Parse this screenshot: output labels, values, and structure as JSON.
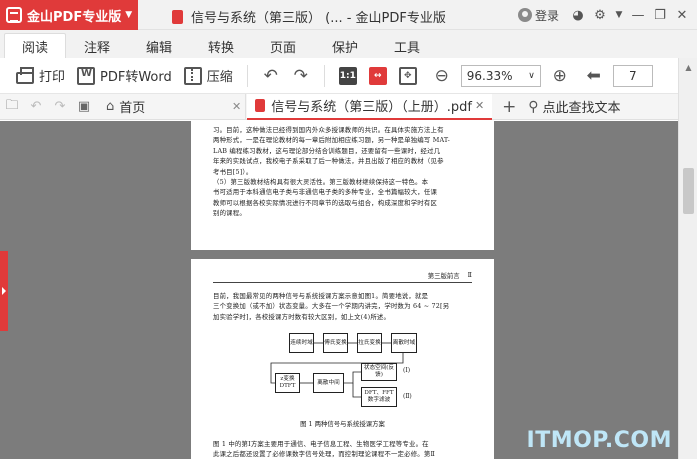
{
  "app": {
    "name": "金山PDF专业版",
    "window_title": "信号与系统（第三版） (... - 金山PDF专业版",
    "login_label": "登录",
    "brand_color": "#e03a3a"
  },
  "window_controls": [
    "chat-icon",
    "settings-icon",
    "dropdown-icon",
    "minimize-icon",
    "restore-icon",
    "close-icon"
  ],
  "menu": {
    "items": [
      "阅读",
      "注释",
      "编辑",
      "转换",
      "页面",
      "保护",
      "工具"
    ],
    "active": "阅读"
  },
  "toolbar": {
    "print_label": "打印",
    "pdf_to_word_label": "PDF转Word",
    "compress_label": "压缩",
    "actual_size_label": "1:1",
    "zoom_value": "96.33%",
    "page_number": "7"
  },
  "tabs": {
    "home_label": "首页",
    "doc_label": "信号与系统（第三版）（上册）.pdf",
    "search_label": "点此查找文本"
  },
  "document": {
    "page1_lines": [
      "习。目前，这种做法已经得到国内外众多授课教师的共识。在具体实施方法上有",
      "两种形式，一是在理论教材的每一章后附加相应练习题，另一种是单独编写 MAT-",
      "LAB 编程练习教材，这与理论部分结合训练题目，还要留有一些课时，经过几",
      "年来的实践试点，我校电子系采取了后一种做法，并且出版了相应的教材（见参",
      "考书目[5]）。",
      "（5）第三版教材结构具有很大灵活性。第三版教材继续保持这一特色。本",
      "书可适用于本科通信电子类与非通信电子类的多种专业，全书篇幅较大，任课",
      "教师可以根据各校实际情况进行不同章节的选取与组合，构成深度和学时有区",
      "别的课程。"
    ],
    "page2_header_title": "第三版前言",
    "page2_header_num": "Ⅱ",
    "page2_intro_lines": [
      "目前，我国最常见的两种信号与系统授课方案示意如图1。简要地说，就是",
      "三个变换加（或不加）状态变量。大多在一个学期内讲完，学时数为 64 ~ 72[另",
      "加实验学时]，各校授课方时数有较大区别，如上文(4)所述。"
    ],
    "diagram_blocks": [
      "连续时域",
      "傅氏变换",
      "拉氏变换",
      "离散时域",
      "z变换DTFT",
      "离散中间",
      "状态空间(反馈)",
      "DFT、FFT数字滤波"
    ],
    "diagram_labels": [
      "(Ⅰ)",
      "(Ⅱ)"
    ],
    "figure_caption": "图 1   两种信号与系统授课方案",
    "page2_after_lines": [
      "图 1 中的第Ⅰ方案主要用于通信、电子信息工程、生物医学工程等专业。在",
      "此课之后都还设置了必修课数字信号处理，而控制理论课程不一定必修。第Ⅱ"
    ]
  },
  "watermark": "ITMOP.COM"
}
